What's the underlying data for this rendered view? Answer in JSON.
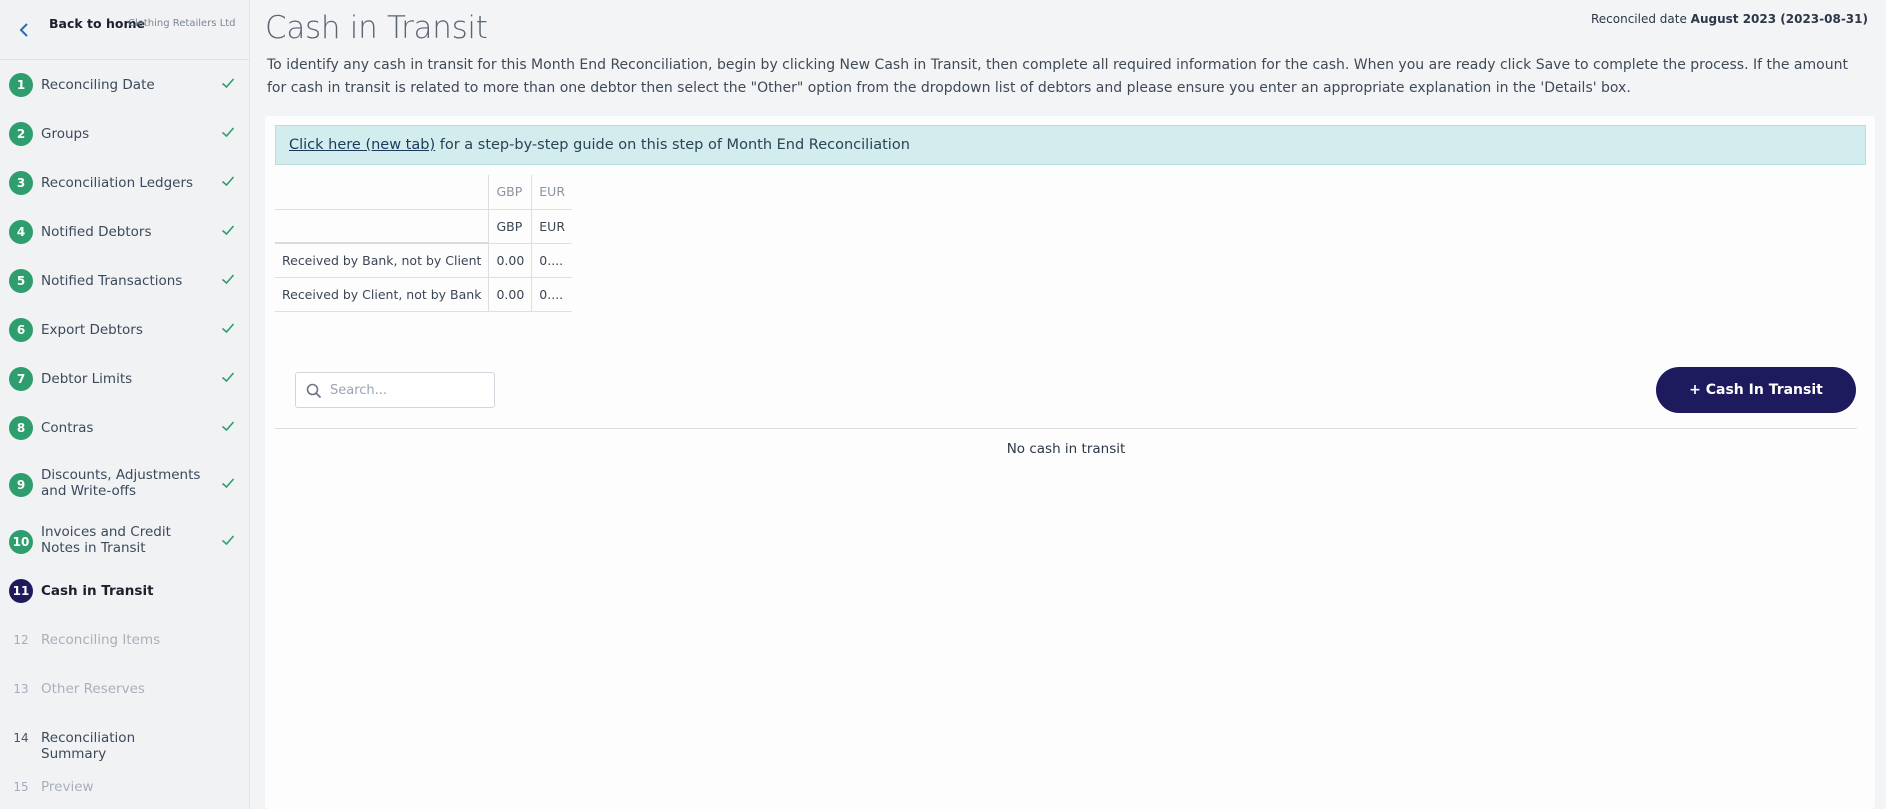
{
  "sidebar": {
    "back_label": "Back to home",
    "company": "Clothing Retailers Ltd",
    "steps": [
      {
        "num": "1",
        "label": "Reconciling Date",
        "state": "done"
      },
      {
        "num": "2",
        "label": "Groups",
        "state": "done"
      },
      {
        "num": "3",
        "label": "Reconciliation Ledgers",
        "state": "done"
      },
      {
        "num": "4",
        "label": "Notified Debtors",
        "state": "done"
      },
      {
        "num": "5",
        "label": "Notified Transactions",
        "state": "done"
      },
      {
        "num": "6",
        "label": "Export Debtors",
        "state": "done"
      },
      {
        "num": "7",
        "label": "Debtor Limits",
        "state": "done"
      },
      {
        "num": "8",
        "label": "Contras",
        "state": "done"
      },
      {
        "num": "9",
        "label": "Discounts, Adjustments and Write-offs",
        "state": "done"
      },
      {
        "num": "10",
        "label": "Invoices and Credit Notes in Transit",
        "state": "done"
      },
      {
        "num": "11",
        "label": "Cash in Transit",
        "state": "active"
      },
      {
        "num": "12",
        "label": "Reconciling Items",
        "state": "disabled"
      },
      {
        "num": "13",
        "label": "Other Reserves",
        "state": "disabled"
      },
      {
        "num": "14",
        "label": "Reconciliation Summary",
        "state": "available"
      },
      {
        "num": "15",
        "label": "Preview",
        "state": "disabled"
      }
    ]
  },
  "header": {
    "title": "Cash in Transit",
    "reconciled_prefix": "Reconciled date ",
    "reconciled_value": "August 2023 (2023-08-31)"
  },
  "intro": "To identify any cash in transit for this Month End Reconciliation, begin by clicking New Cash in Transit, then complete all required information for the cash. When you are ready click Save to complete the process. If the amount for cash in transit is related to more than one debtor then select the \"Other\" option from the dropdown list of debtors and please ensure you enter an appropriate explanation in the 'Details' box.",
  "guide": {
    "link_text": "Click here (new tab)",
    "rest_text": " for a step-by-step guide on this step of Month End Reconciliation"
  },
  "totals": {
    "currency_header": [
      "GBP",
      "EUR"
    ],
    "currency_row": [
      "GBP",
      "EUR"
    ],
    "rows": [
      {
        "label": "Received by Bank, not by Client",
        "values": [
          "0.00",
          "0...."
        ]
      },
      {
        "label": "Received by Client, not by Bank",
        "values": [
          "0.00",
          "0...."
        ]
      }
    ]
  },
  "search": {
    "placeholder": "Search..."
  },
  "add_button": "+ Cash In Transit",
  "empty_message": "No cash in transit",
  "colors": {
    "done": "#2f9e6f",
    "active": "#1d1b5e",
    "banner": "#d3ecee"
  }
}
